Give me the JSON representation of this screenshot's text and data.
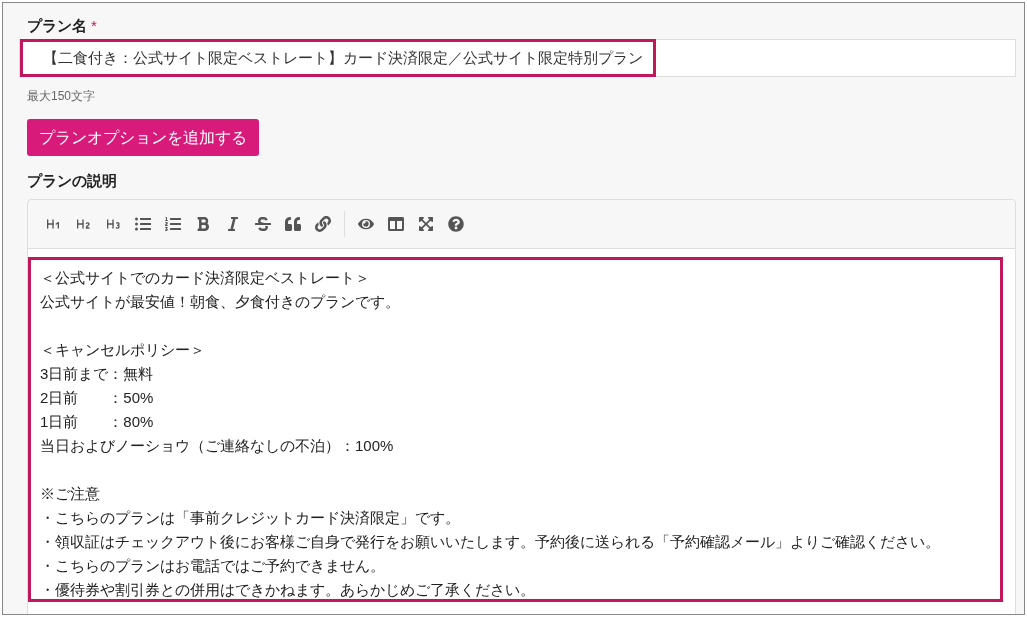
{
  "plan_name": {
    "label": "プラン名",
    "required_mark": "*",
    "value": "【二食付き：公式サイト限定ベストレート】カード決済限定／公式サイト限定特別プラン",
    "hint": "最大150文字"
  },
  "add_option_button": "プランオプションを追加する",
  "description": {
    "label": "プランの説明",
    "paragraphs": [
      [
        "＜公式サイトでのカード決済限定ベストレート＞",
        "公式サイトが最安値！朝食、夕食付きのプランです。"
      ],
      [
        "＜キャンセルポリシー＞",
        "3日前まで：無料",
        "2日前　　：50%",
        "1日前　　：80%",
        "当日およびノーショウ（ご連絡なしの不泊）：100%"
      ],
      [
        "※ご注意",
        "・こちらのプランは「事前クレジットカード決済限定」です。",
        "・領収証はチェックアウト後にお客様ご自身で発行をお願いいたします。予約後に送られる「予約確認メール」よりご確認ください。",
        "・こちらのプランはお電話ではご予約できません。",
        "・優待券や割引券との併用はできかねます。あらかじめご了承ください。"
      ]
    ]
  }
}
